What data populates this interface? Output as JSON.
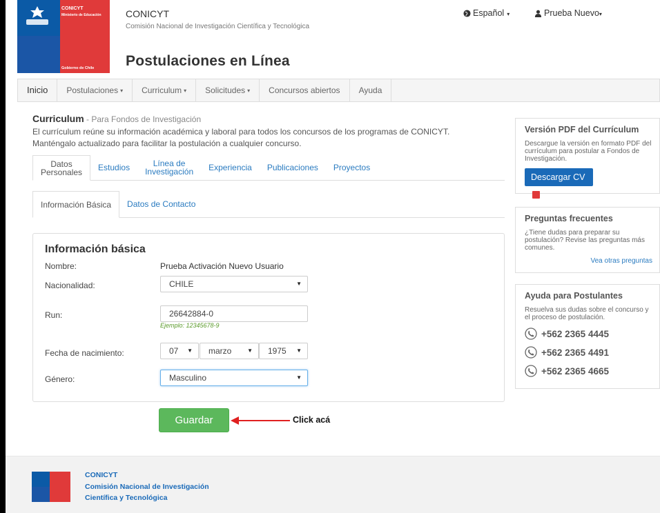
{
  "header": {
    "logo_line1": "CONICYT",
    "logo_line2": "Ministerio de Educación",
    "logo_line3": "Gobierno de Chile",
    "org_name": "CONICYT",
    "org_full": "Comisión Nacional de Investigación Científica y Tecnológica",
    "app_title": "Postulaciones en Línea",
    "language": "Español",
    "user": "Prueba Nuevo"
  },
  "navbar": {
    "items": [
      {
        "label": "Inicio",
        "caret": ""
      },
      {
        "label": "Postulaciones",
        "caret": "▾"
      },
      {
        "label": "Curriculum",
        "caret": "▾"
      },
      {
        "label": "Solicitudes",
        "caret": "▾"
      },
      {
        "label": "Concursos abiertos",
        "caret": ""
      },
      {
        "label": "Ayuda",
        "caret": ""
      }
    ]
  },
  "curriculum": {
    "heading": "Curriculum",
    "subheading": " - Para Fondos de Investigación",
    "description": "El currículum reúne su información académica y laboral para todos los concursos de los programas de CONICYT. Manténgalo actualizado para facilitar la postulación a cualquier concurso.",
    "tabs": [
      {
        "line1": "Datos",
        "line2": "Personales"
      },
      {
        "line1": "Estudios",
        "line2": ""
      },
      {
        "line1": "Línea de",
        "line2": "Investigación"
      },
      {
        "line1": "Experiencia",
        "line2": ""
      },
      {
        "line1": "Publicaciones",
        "line2": ""
      },
      {
        "line1": "Proyectos",
        "line2": ""
      }
    ],
    "subtabs": [
      "Información Básica",
      "Datos de Contacto"
    ]
  },
  "form": {
    "title": "Información básica",
    "nombre_label": "Nombre:",
    "nombre_value": "Prueba Activación Nuevo Usuario",
    "nacionalidad_label": "Nacionalidad:",
    "nacionalidad_value": "CHILE",
    "run_label": "Run:",
    "run_value": "26642884-0",
    "run_hint": "Ejemplo: 12345678-9",
    "fecha_label": "Fecha de nacimiento:",
    "fecha_day": "07",
    "fecha_month": "marzo",
    "fecha_year": "1975",
    "genero_label": "Género:",
    "genero_value": "Masculino",
    "save_label": "Guardar",
    "annotation": "Click acá"
  },
  "sidebar": {
    "pdf_title": "Versión PDF del Currículum",
    "pdf_text": "Descargue la versión en formato PDF del currículum para postular a Fondos de Investigación.",
    "pdf_button": "Descargar CV",
    "faq_title": "Preguntas frecuentes",
    "faq_text": "¿Tiene dudas para preparar su postulación? Revise las preguntas más comunes.",
    "faq_link": "Vea otras preguntas",
    "help_title": "Ayuda para Postulantes",
    "help_text": "Resuelva sus dudas sobre el concurso y el proceso de postulación.",
    "phones": [
      "+562 2365 4445",
      "+562 2365 4491",
      "+562 2365 4665"
    ]
  },
  "footer": {
    "line1": "CONICYT",
    "line2": "Comisión Nacional de Investigación",
    "line3": "Científica y Tecnológica"
  },
  "colors": {
    "primary_blue": "#1a6ab8",
    "brand_red": "#e03a3a",
    "save_green": "#5cb85c",
    "annotation_red": "#e02020"
  },
  "icons": {
    "language": "globe-icon",
    "user": "user-icon",
    "phone": "phone-icon",
    "pdf": "pdf-icon",
    "dropdown": "caret-down-icon"
  }
}
